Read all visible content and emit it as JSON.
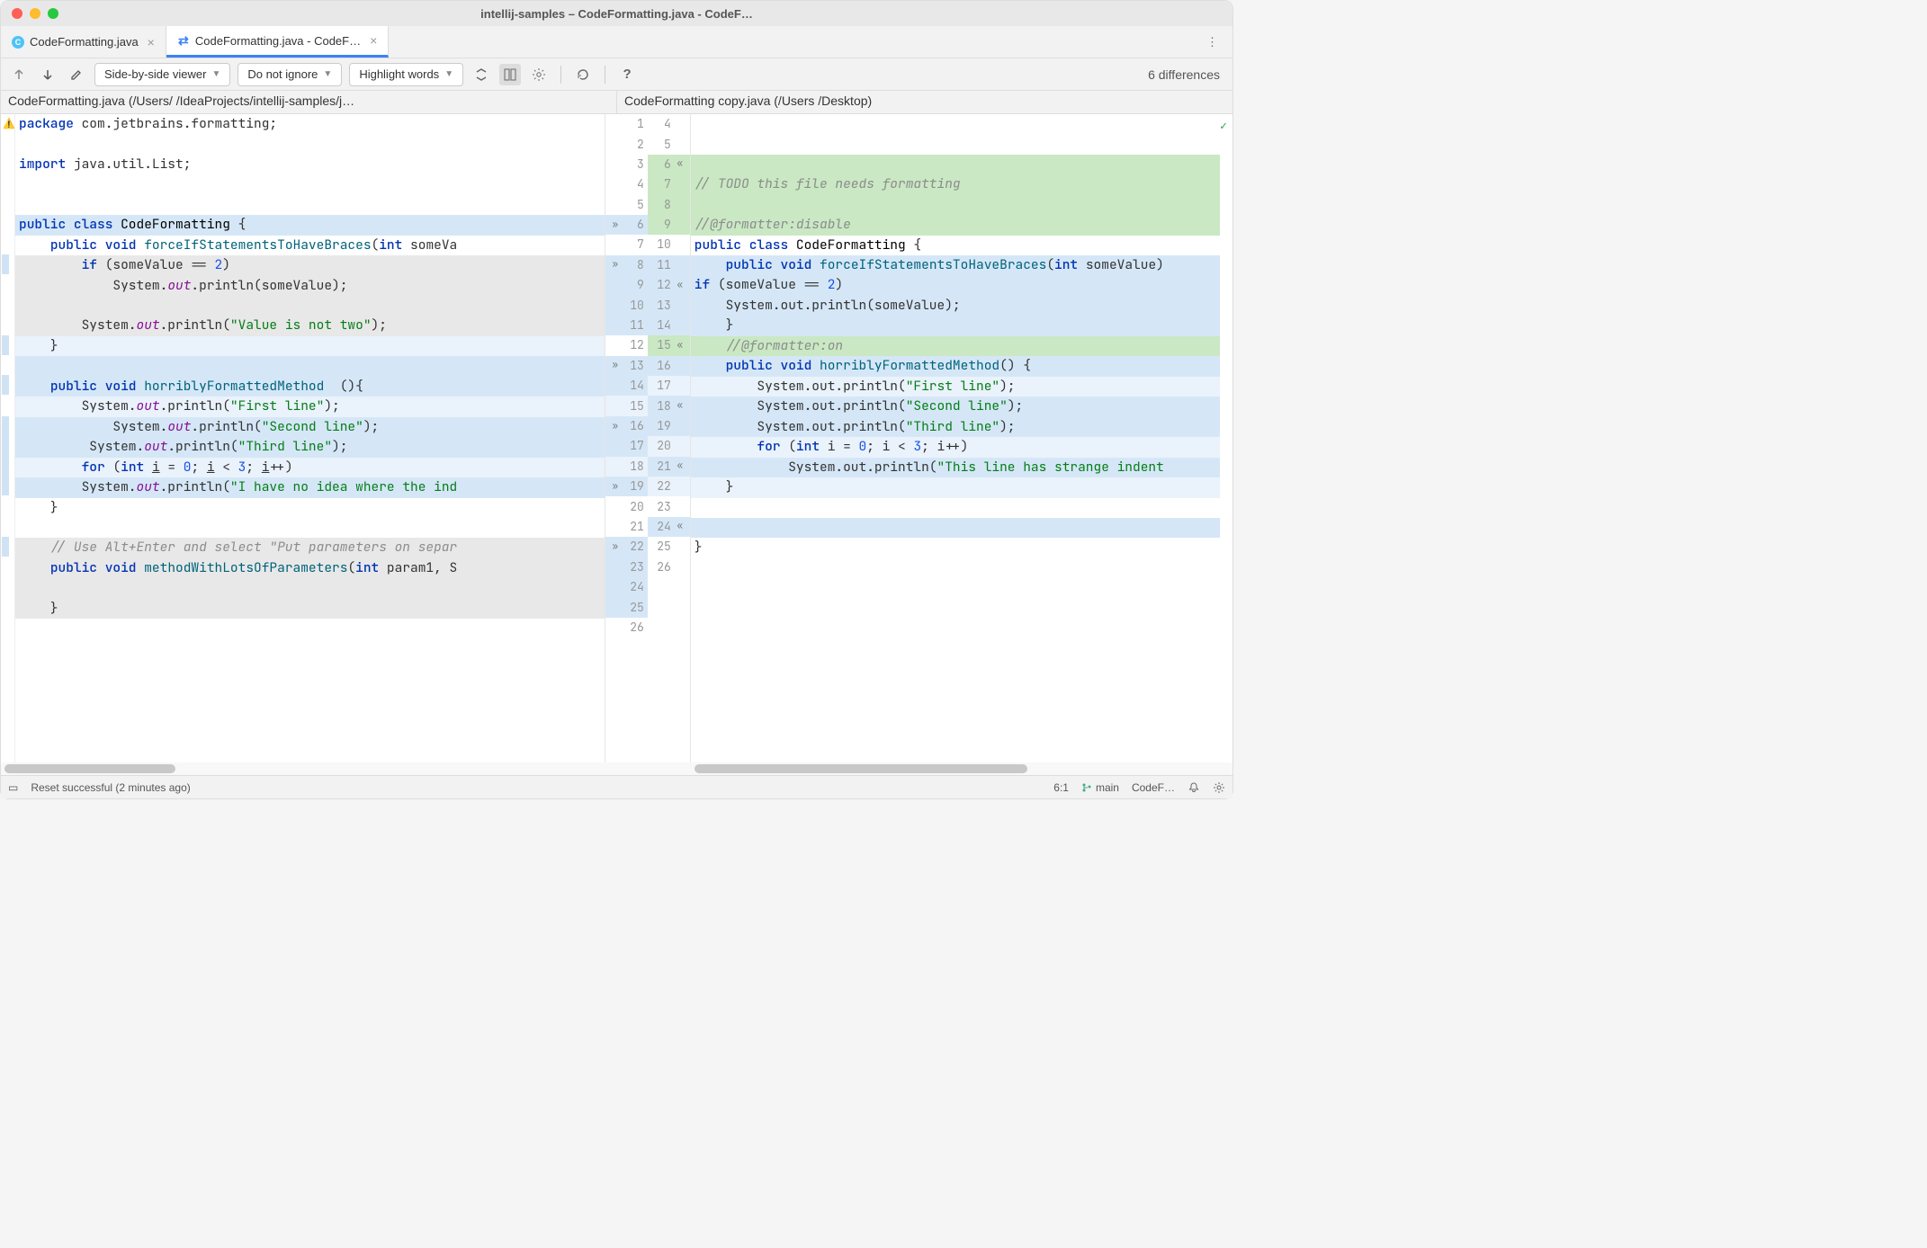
{
  "window": {
    "title": "intellij-samples – CodeFormatting.java - CodeF…"
  },
  "tabs": [
    {
      "label": "CodeFormatting.java",
      "active": false,
      "icon": "c"
    },
    {
      "label": "CodeFormatting.java - CodeF…",
      "active": true,
      "icon": "diff"
    }
  ],
  "toolbar": {
    "viewer_mode": "Side-by-side viewer",
    "whitespace": "Do not ignore",
    "highlight": "Highlight words",
    "diff_count": "6 differences"
  },
  "paths": {
    "left": "CodeFormatting.java (/Users/                              /IdeaProjects/intellij-samples/j…",
    "right": "CodeFormatting copy.java (/Users /Desktop)"
  },
  "left_code": {
    "l1_html": "<span class='kw'>package</span> com.jetbrains.formatting;",
    "l2_html": "",
    "l3_html": "<span class='kw'>import</span> java.util.List;",
    "l4_html": "",
    "l5_html": "",
    "l6_html": "<span class='kw'>public class</span> <span class='type'>CodeFormatting</span> {",
    "l7_html": "    <span class='kw'>public void</span> <span class='method'>forceIfStatementsToHaveBraces</span>(<span class='kw'>int</span> someVa",
    "l8_html": "        <span class='kw'>if</span> (someValue == <span class='num'>2</span>)",
    "l9_html": "            System.<span class='field'>out</span>.println(someValue);",
    "l10_html": "",
    "l11_html": "        System.<span class='field'>out</span>.println(<span class='str'>\"Value is not two\"</span>);",
    "l12_html": "    }",
    "l13_html": "",
    "l14_html": "    <span class='kw'>public void</span> <span class='method'>horriblyFormattedMethod</span>  (){",
    "l15_html": "        System.<span class='field'>out</span>.println(<span class='str'>\"First line\"</span>);",
    "l16_html": "            System.<span class='field'>out</span>.println(<span class='str'>\"Second line\"</span>);",
    "l17_html": "         System.<span class='field'>out</span>.println(<span class='str'>\"Third line\"</span>);",
    "l18_html": "        <span class='kw'>for</span> (<span class='kw'>int</span> <u>i</u> = <span class='num'>0</span>; <u>i</u> &lt; <span class='num'>3</span>; <u>i</u>++)",
    "l19_html": "        System.<span class='field'>out</span>.println(<span class='str'>\"I have no idea where the ind</span>",
    "l20_html": "    }",
    "l21_html": "",
    "l22_html": "    <span class='cmt'>// Use Alt+Enter and select \"Put parameters on separ</span>",
    "l23_html": "    <span class='kw'>public void</span> <span class='method'>methodWithLotsOfParameters</span>(<span class='kw'>int</span> param1, S",
    "l24_html": "",
    "l25_html": "    }",
    "l26_html": ""
  },
  "right_code": {
    "r6_html": "",
    "r7_html": "<span class='cmt'>// TODO this file needs formatting</span>",
    "r8_html": "",
    "r9_html": "<span class='cmt'>//@formatter:disable</span>",
    "r10_html": "<span class='kw'>public class</span> <span class='type'>CodeFormatting</span> {",
    "r11_html": "    <span class='kw'>public void</span> <span class='method'>forceIfStatementsToHaveBraces</span>(<span class='kw'>int</span> someValue)",
    "r12_html": "<span class='kw'>if</span> (someValue == <span class='num'>2</span>)",
    "r13_html": "    System.out.println(someValue);",
    "r14_html": "    }",
    "r15_html": "    <span class='cmt'>//@formatter:on</span>",
    "r16_html": "    <span class='kw'>public void</span> <span class='method'>horriblyFormattedMethod</span>() {",
    "r17_html": "        System.out.println(<span class='str'>\"First line\"</span>);",
    "r18_html": "        System.out.println(<span class='str'>\"Second line\"</span>);",
    "r19_html": "        System.out.println(<span class='str'>\"Third line\"</span>);",
    "r20_html": "        <span class='kw'>for</span> (<span class='kw'>int</span> i = <span class='num'>0</span>; i &lt; <span class='num'>3</span>; i++)",
    "r21_html": "            System.out.println(<span class='str'>\"This line has strange indent</span>",
    "r22_html": "    }",
    "r23_html": "",
    "r24_html": "",
    "r25_html": "}",
    "r26_html": ""
  },
  "gutter": [
    {
      "l": "1",
      "r": "4",
      "la": "",
      "ra": "",
      "lb": "",
      "rb": ""
    },
    {
      "l": "2",
      "r": "5",
      "la": "",
      "ra": "",
      "lb": "",
      "rb": ""
    },
    {
      "l": "3",
      "r": "6",
      "la": "",
      "ra": "«",
      "lb": "",
      "rb": "cg-green"
    },
    {
      "l": "4",
      "r": "7",
      "la": "",
      "ra": "",
      "lb": "",
      "rb": "cg-green"
    },
    {
      "l": "5",
      "r": "8",
      "la": "",
      "ra": "",
      "lb": "",
      "rb": "cg-green"
    },
    {
      "l": "6",
      "r": "9",
      "la": "»",
      "ra": "",
      "lb": "cg-blue",
      "rb": "cg-green"
    },
    {
      "l": "7",
      "r": "10",
      "la": "",
      "ra": "",
      "lb": "",
      "rb": ""
    },
    {
      "l": "8",
      "r": "11",
      "la": "»",
      "ra": "",
      "lb": "cg-blue",
      "rb": "cg-blue"
    },
    {
      "l": "9",
      "r": "12",
      "la": "",
      "ra": "«",
      "lb": "cg-blue",
      "rb": "cg-blue"
    },
    {
      "l": "10",
      "r": "13",
      "la": "",
      "ra": "",
      "lb": "cg-blue",
      "rb": "cg-blue"
    },
    {
      "l": "11",
      "r": "14",
      "la": "",
      "ra": "",
      "lb": "cg-blue",
      "rb": "cg-blue"
    },
    {
      "l": "12",
      "r": "15",
      "la": "",
      "ra": "«",
      "lb": "",
      "rb": "cg-green"
    },
    {
      "l": "13",
      "r": "16",
      "la": "»",
      "ra": "",
      "lb": "cg-blue",
      "rb": "cg-blue"
    },
    {
      "l": "14",
      "r": "17",
      "la": "",
      "ra": "",
      "lb": "cg-blue",
      "rb": "cg-blue-light"
    },
    {
      "l": "15",
      "r": "18",
      "la": "",
      "ra": "«",
      "lb": "cg-blue-light",
      "rb": "cg-blue"
    },
    {
      "l": "16",
      "r": "19",
      "la": "»",
      "ra": "",
      "lb": "cg-blue",
      "rb": "cg-blue"
    },
    {
      "l": "17",
      "r": "20",
      "la": "",
      "ra": "",
      "lb": "cg-blue",
      "rb": "cg-blue-light"
    },
    {
      "l": "18",
      "r": "21",
      "la": "",
      "ra": "«",
      "lb": "cg-blue-light",
      "rb": "cg-blue"
    },
    {
      "l": "19",
      "r": "22",
      "la": "»",
      "ra": "",
      "lb": "cg-blue",
      "rb": "cg-blue-light"
    },
    {
      "l": "20",
      "r": "23",
      "la": "",
      "ra": "",
      "lb": "",
      "rb": ""
    },
    {
      "l": "21",
      "r": "24",
      "la": "",
      "ra": "«",
      "lb": "",
      "rb": "cg-blue"
    },
    {
      "l": "22",
      "r": "25",
      "la": "»",
      "ra": "",
      "lb": "cg-blue",
      "rb": ""
    },
    {
      "l": "23",
      "r": "26",
      "la": "",
      "ra": "",
      "lb": "cg-blue",
      "rb": ""
    },
    {
      "l": "24",
      "r": "",
      "la": "",
      "ra": "",
      "lb": "cg-blue",
      "rb": ""
    },
    {
      "l": "25",
      "r": "",
      "la": "",
      "ra": "",
      "lb": "cg-blue",
      "rb": ""
    },
    {
      "l": "26",
      "r": "",
      "la": "",
      "ra": "",
      "lb": "",
      "rb": ""
    }
  ],
  "left_rows": [
    {
      "k": "l1_html",
      "bg": ""
    },
    {
      "k": "l2_html",
      "bg": ""
    },
    {
      "k": "l3_html",
      "bg": ""
    },
    {
      "k": "l4_html",
      "bg": ""
    },
    {
      "k": "l5_html",
      "bg": ""
    },
    {
      "k": "l6_html",
      "bg": "bg-blue"
    },
    {
      "k": "l7_html",
      "bg": ""
    },
    {
      "k": "l8_html",
      "bg": "bg-gray"
    },
    {
      "k": "l9_html",
      "bg": "bg-gray"
    },
    {
      "k": "l10_html",
      "bg": "bg-gray"
    },
    {
      "k": "l11_html",
      "bg": "bg-gray"
    },
    {
      "k": "l12_html",
      "bg": "bg-blue-light"
    },
    {
      "k": "l13_html",
      "bg": "bg-blue"
    },
    {
      "k": "l14_html",
      "bg": "bg-blue"
    },
    {
      "k": "l15_html",
      "bg": "bg-blue-light"
    },
    {
      "k": "l16_html",
      "bg": "bg-blue"
    },
    {
      "k": "l17_html",
      "bg": "bg-blue"
    },
    {
      "k": "l18_html",
      "bg": "bg-blue-light"
    },
    {
      "k": "l19_html",
      "bg": "bg-blue"
    },
    {
      "k": "l20_html",
      "bg": ""
    },
    {
      "k": "l21_html",
      "bg": ""
    },
    {
      "k": "l22_html",
      "bg": "bg-gray"
    },
    {
      "k": "l23_html",
      "bg": "bg-gray"
    },
    {
      "k": "l24_html",
      "bg": "bg-gray"
    },
    {
      "k": "l25_html",
      "bg": "bg-gray"
    },
    {
      "k": "l26_html",
      "bg": ""
    }
  ],
  "right_rows": [
    {
      "k": "",
      "bg": ""
    },
    {
      "k": "",
      "bg": ""
    },
    {
      "k": "r6_html",
      "bg": "bg-green"
    },
    {
      "k": "r7_html",
      "bg": "bg-green"
    },
    {
      "k": "r8_html",
      "bg": "bg-green"
    },
    {
      "k": "r9_html",
      "bg": "bg-green"
    },
    {
      "k": "r10_html",
      "bg": ""
    },
    {
      "k": "r11_html",
      "bg": "bg-blue"
    },
    {
      "k": "r12_html",
      "bg": "bg-blue"
    },
    {
      "k": "r13_html",
      "bg": "bg-blue"
    },
    {
      "k": "r14_html",
      "bg": "bg-blue"
    },
    {
      "k": "r15_html",
      "bg": "bg-green"
    },
    {
      "k": "r16_html",
      "bg": "bg-blue"
    },
    {
      "k": "r17_html",
      "bg": "bg-blue-light"
    },
    {
      "k": "r18_html",
      "bg": "bg-blue"
    },
    {
      "k": "r19_html",
      "bg": "bg-blue"
    },
    {
      "k": "r20_html",
      "bg": "bg-blue-light"
    },
    {
      "k": "r21_html",
      "bg": "bg-blue"
    },
    {
      "k": "r22_html",
      "bg": "bg-blue-light"
    },
    {
      "k": "r23_html",
      "bg": ""
    },
    {
      "k": "r24_html",
      "bg": "bg-blue"
    },
    {
      "k": "r25_html",
      "bg": ""
    },
    {
      "k": "r26_html",
      "bg": ""
    },
    {
      "k": "",
      "bg": ""
    },
    {
      "k": "",
      "bg": ""
    },
    {
      "k": "",
      "bg": ""
    }
  ],
  "status": {
    "message": "Reset successful (2 minutes ago)",
    "line_col": "6:1",
    "branch": "main",
    "extra": "CodeF…"
  }
}
